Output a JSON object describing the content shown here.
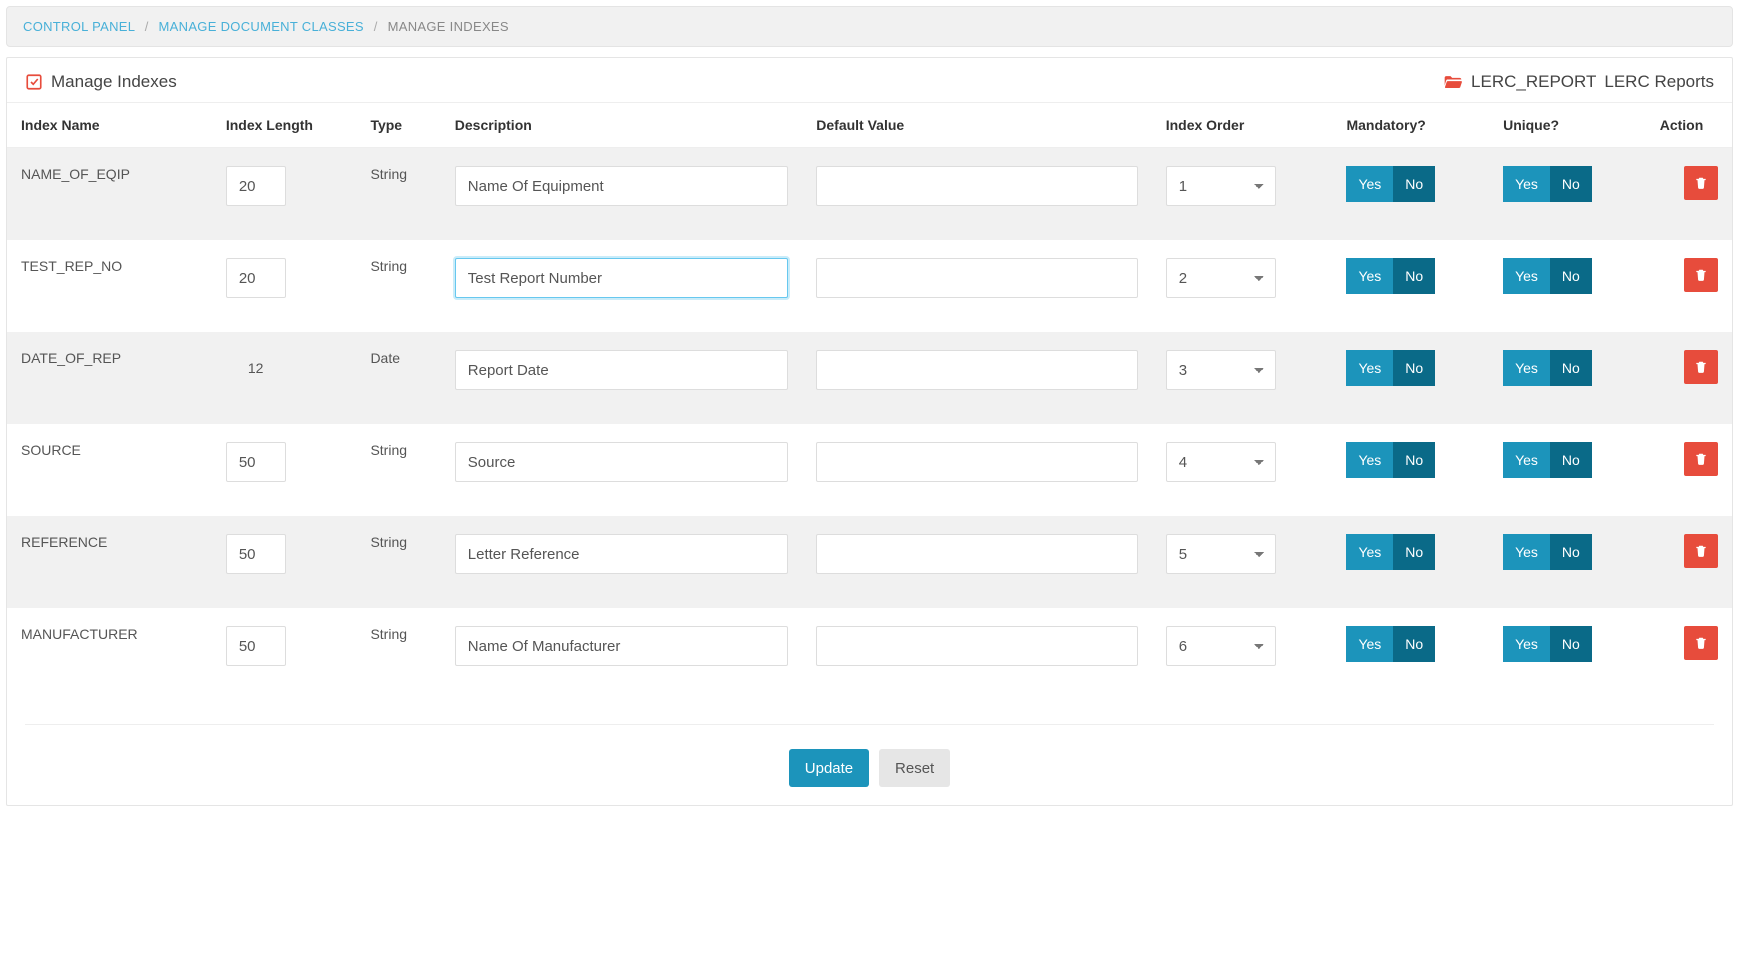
{
  "breadcrumb": {
    "items": [
      "Control Panel",
      "Manage Document Classes",
      "Manage Indexes"
    ]
  },
  "header": {
    "title": "Manage Indexes",
    "context_code": "LERC_REPORT",
    "context_name": "LERC Reports"
  },
  "columns": {
    "name": "Index Name",
    "length": "Index Length",
    "type": "Type",
    "description": "Description",
    "default": "Default Value",
    "order": "Index Order",
    "mandatory": "Mandatory?",
    "unique": "Unique?",
    "action": "Action"
  },
  "toggle": {
    "yes": "Yes",
    "no": "No"
  },
  "buttons": {
    "update": "Update",
    "reset": "Reset"
  },
  "rows": [
    {
      "name": "NAME_OF_EQIP",
      "length": "20",
      "length_editable": true,
      "type": "String",
      "description": "Name Of Equipment",
      "default": "",
      "order": "1",
      "focused": false
    },
    {
      "name": "TEST_REP_NO",
      "length": "20",
      "length_editable": true,
      "type": "String",
      "description": "Test Report Number",
      "default": "",
      "order": "2",
      "focused": true
    },
    {
      "name": "DATE_OF_REP",
      "length": "12",
      "length_editable": false,
      "type": "Date",
      "description": "Report Date",
      "default": "",
      "order": "3",
      "focused": false
    },
    {
      "name": "SOURCE",
      "length": "50",
      "length_editable": true,
      "type": "String",
      "description": "Source",
      "default": "",
      "order": "4",
      "focused": false
    },
    {
      "name": "REFERENCE",
      "length": "50",
      "length_editable": true,
      "type": "String",
      "description": "Letter Reference",
      "default": "",
      "order": "5",
      "focused": false
    },
    {
      "name": "MANUFACTURER",
      "length": "50",
      "length_editable": true,
      "type": "String",
      "description": "Name Of Manufacturer",
      "default": "",
      "order": "6",
      "focused": false
    }
  ]
}
